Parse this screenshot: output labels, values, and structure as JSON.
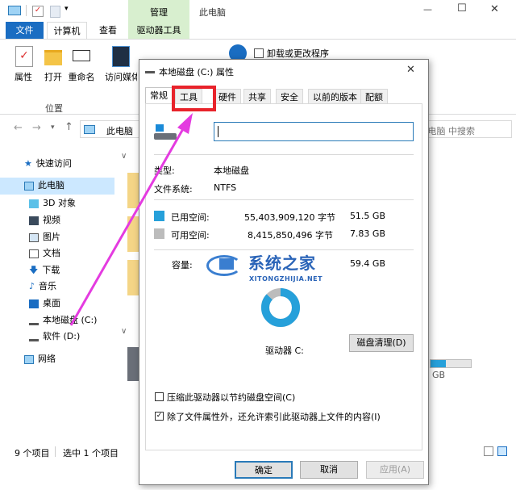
{
  "explorer": {
    "title": "此电脑",
    "manage_tab": "管理",
    "tabs": [
      "文件",
      "计算机",
      "查看",
      "驱动器工具"
    ],
    "ribbon": {
      "properties": "属性",
      "open": "打开",
      "rename": "重命名",
      "access_media": "访问媒体",
      "uninstall": "卸载或更改程序",
      "group_location": "位置"
    },
    "address": "此电脑",
    "search_placeholder": "在 此电脑 中搜索",
    "nav": {
      "quick_access": "快速访问",
      "this_pc": "此电脑",
      "objects3d": "3D 对象",
      "videos": "视频",
      "pictures": "图片",
      "documents": "文档",
      "downloads": "下载",
      "music": "音乐",
      "desktop": "桌面",
      "local_c": "本地磁盘 (C:)",
      "soft_d": "软件 (D:)",
      "network": "网络"
    },
    "main": {
      "d_size": "GB",
      "d_usage_fraction": 0.38
    },
    "status": {
      "item_count": "9 个项目",
      "selected": "选中 1 个项目"
    },
    "window_controls": {
      "minimize": "—",
      "maximize": "☐",
      "close": "✕"
    }
  },
  "dialog": {
    "title": "本地磁盘 (C:) 属性",
    "close": "✕",
    "tabs": [
      "常规",
      "工具",
      "硬件",
      "共享",
      "安全",
      "以前的版本",
      "配额"
    ],
    "name_value": "",
    "type_label": "类型:",
    "type_value": "本地磁盘",
    "fs_label": "文件系统:",
    "fs_value": "NTFS",
    "used_label": "已用空间:",
    "used_bytes": "55,403,909,120 字节",
    "used_gb": "51.5 GB",
    "free_label": "可用空间:",
    "free_bytes": "8,415,850,496 字节",
    "free_gb": "7.83 GB",
    "capacity_label": "容量:",
    "capacity_gb": "59.4 GB",
    "used_fraction": 0.87,
    "drive_label": "驱动器 C:",
    "cleanup_btn": "磁盘清理(D)",
    "compress_label": "压缩此驱动器以节约磁盘空间(C)",
    "index_label": "除了文件属性外，还允许索引此驱动器上文件的内容(I)",
    "ok": "确定",
    "cancel": "取消",
    "apply": "应用(A)",
    "colors": {
      "used": "#26a0da",
      "free": "#bcbcbc"
    }
  },
  "watermark": {
    "text_cn": "系统之家",
    "text_en": "XITONGZHIJIA.NET"
  }
}
